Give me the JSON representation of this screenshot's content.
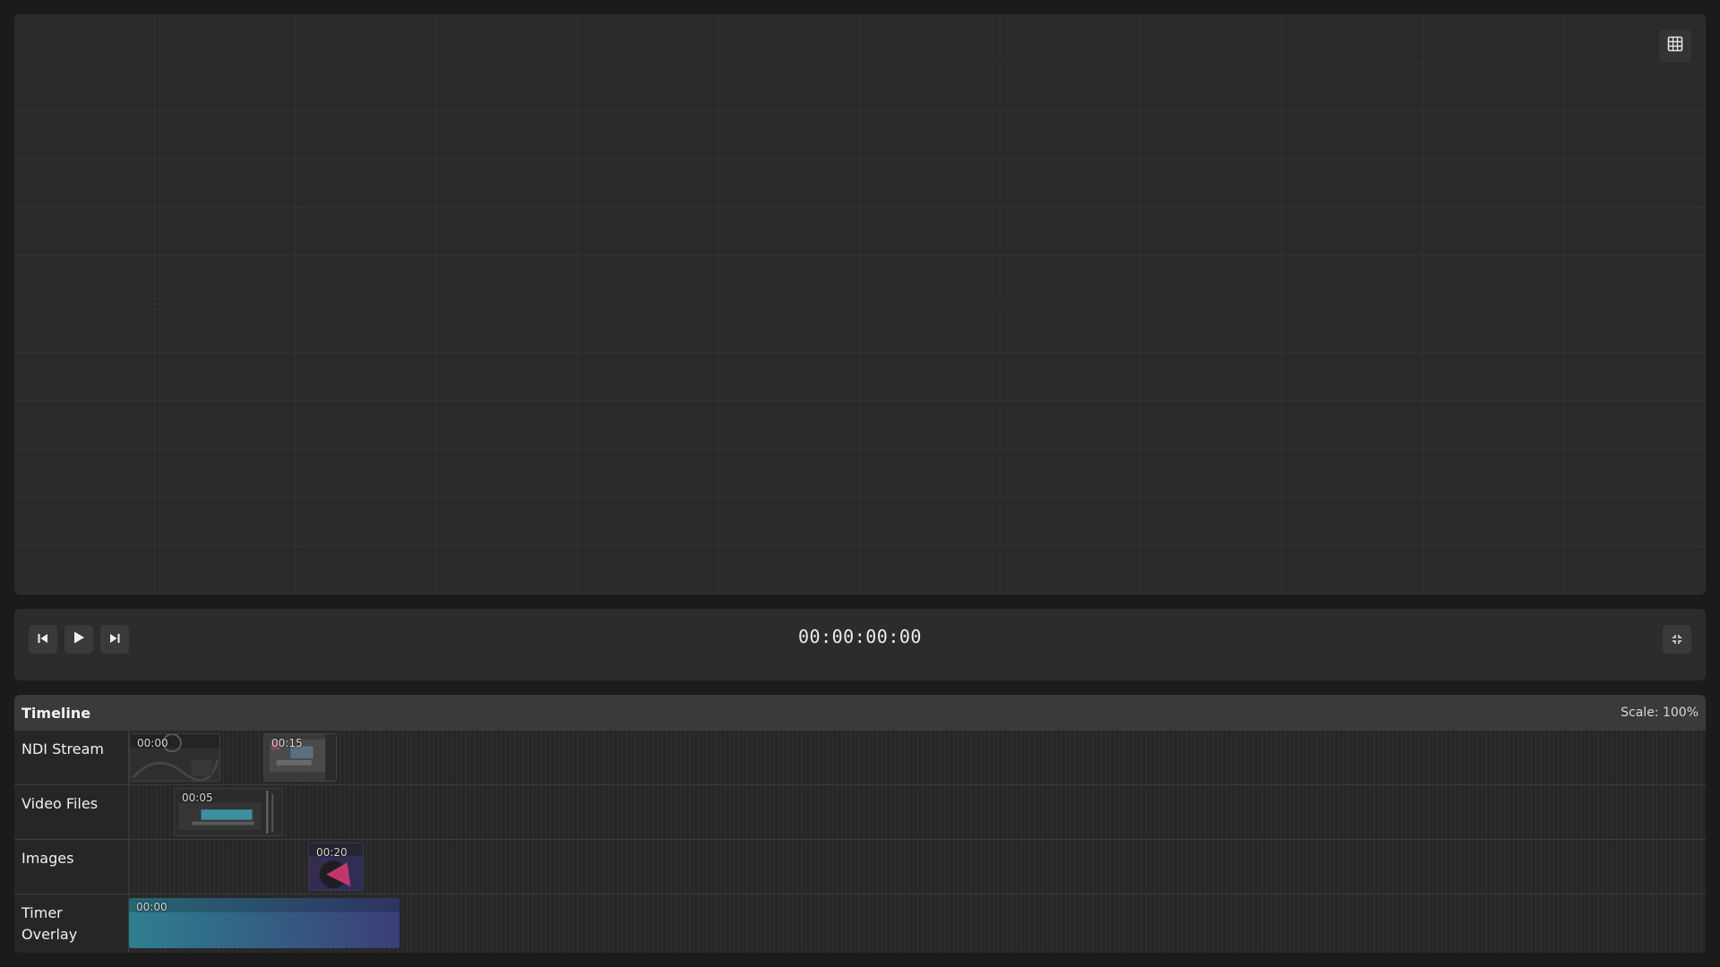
{
  "preview": {
    "grid_toggle_icon": "grid-icon"
  },
  "transport": {
    "skip_back_icon": "skip-back-icon",
    "play_icon": "play-icon",
    "skip_forward_icon": "skip-forward-icon",
    "timecode": "00:00:00:00",
    "collapse_icon": "collapse-icon"
  },
  "timeline": {
    "title": "Timeline",
    "scale": "Scale: 100%",
    "tracks": [
      {
        "label": "NDI Stream",
        "clips": [
          {
            "time": "00:00",
            "kind": "ndi-stream-thumbnail"
          },
          {
            "time": "00:15",
            "kind": "ndi-stream-thumbnail"
          }
        ]
      },
      {
        "label": "Video Files",
        "clips": [
          {
            "time": "00:05",
            "kind": "video-thumbnail"
          }
        ]
      },
      {
        "label": "Images",
        "clips": [
          {
            "time": "00:20",
            "kind": "image-thumbnail"
          }
        ]
      },
      {
        "label": "Timer Overlay",
        "clips": [
          {
            "time": "00:00",
            "kind": "timer-overlay-gradient"
          }
        ]
      }
    ]
  },
  "colors": {
    "background": "#1b1b1b",
    "panel": "#2a2a2a",
    "timeline_header": "#3a3a3a",
    "timer_clip_start": "#2e7f8f",
    "timer_clip_end": "#3a3f78",
    "image_clip_accent": "#c2366e"
  }
}
